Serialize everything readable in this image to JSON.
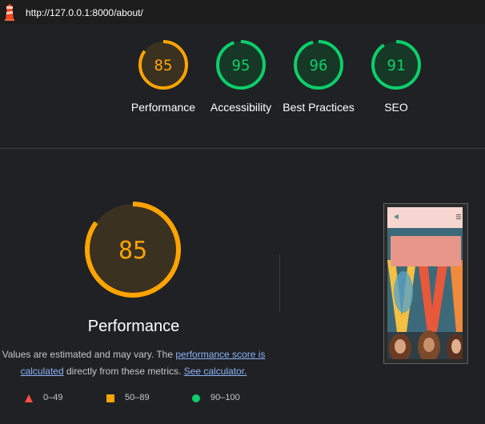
{
  "browser": {
    "url": "http://127.0.0.1:8000/about/",
    "icon": "lighthouse-icon"
  },
  "colors": {
    "good": "#0cce6b",
    "average": "#ffa400",
    "poor": "#ff4e42"
  },
  "categories": [
    {
      "label": "Performance",
      "score": 85,
      "status": "average"
    },
    {
      "label": "Accessibility",
      "score": 95,
      "status": "good"
    },
    {
      "label": "Best Practices",
      "score": 96,
      "status": "good"
    },
    {
      "label": "SEO",
      "score": 91,
      "status": "good"
    }
  ],
  "performance": {
    "title": "Performance",
    "score": 85,
    "desc_prefix": "Values are estimated and may vary. The ",
    "link1": "performance score is calculated",
    "desc_middle": " directly from these metrics. ",
    "link2": "See calculator."
  },
  "legend": [
    {
      "range": "0–49",
      "shape": "triangle"
    },
    {
      "range": "50–89",
      "shape": "square"
    },
    {
      "range": "90–100",
      "shape": "circle"
    }
  ],
  "screenshot": {
    "thumbnail": "page-screenshot-thumbnail"
  }
}
